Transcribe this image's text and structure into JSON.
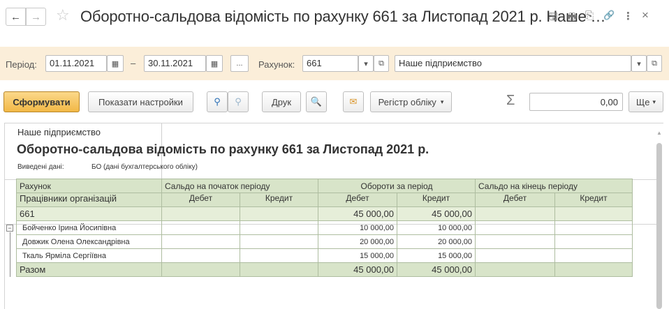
{
  "window": {
    "title": "Оборотно-сальдова відомість по рахунку 661 за Листопад 2021 р. Наше …"
  },
  "icons": {
    "back": "←",
    "forward": "→",
    "star": "☆",
    "save": "🖫",
    "print": "🖶",
    "preview": "⎘",
    "link": "🔗",
    "more": "⋮",
    "close": "×"
  },
  "filters": {
    "period_label": "Період:",
    "date_from": "01.11.2021",
    "date_sep": "–",
    "date_to": "30.11.2021",
    "ellipsis": "...",
    "account_label": "Рахунок:",
    "account": "661",
    "company": "Наше підприємство"
  },
  "toolbar": {
    "generate": "Сформувати",
    "show_settings": "Показати настройки",
    "print": "Друк",
    "register": "Регістр обліку",
    "sum_value": "0,00",
    "more": "Ще"
  },
  "report": {
    "org": "Наше підприємство",
    "title": "Оборотно-сальдова відомість по рахунку 661 за Листопад 2021 р.",
    "shown_label": "Виведені дані:",
    "shown_value": "БО (дані бухгалтерського обліку)",
    "headers": {
      "account": "Рахунок",
      "employees": "Працівники організацій",
      "opening": "Сальдо на початок періоду",
      "turnover": "Обороти за період",
      "closing": "Сальдо на кінець періоду",
      "debit": "Дебет",
      "credit": "Кредит"
    },
    "group": {
      "name": "661",
      "turn_debit": "45 000,00",
      "turn_credit": "45 000,00"
    },
    "rows": [
      {
        "name": "Бойченко Ірина Йосипівна",
        "turn_debit": "10 000,00",
        "turn_credit": "10 000,00"
      },
      {
        "name": "Довжик Олена Олександрівна",
        "turn_debit": "20 000,00",
        "turn_credit": "20 000,00"
      },
      {
        "name": "Ткаль Ярміла Сергіївна",
        "turn_debit": "15 000,00",
        "turn_credit": "15 000,00"
      }
    ],
    "total": {
      "label": "Разом",
      "turn_debit": "45 000,00",
      "turn_credit": "45 000,00"
    }
  }
}
